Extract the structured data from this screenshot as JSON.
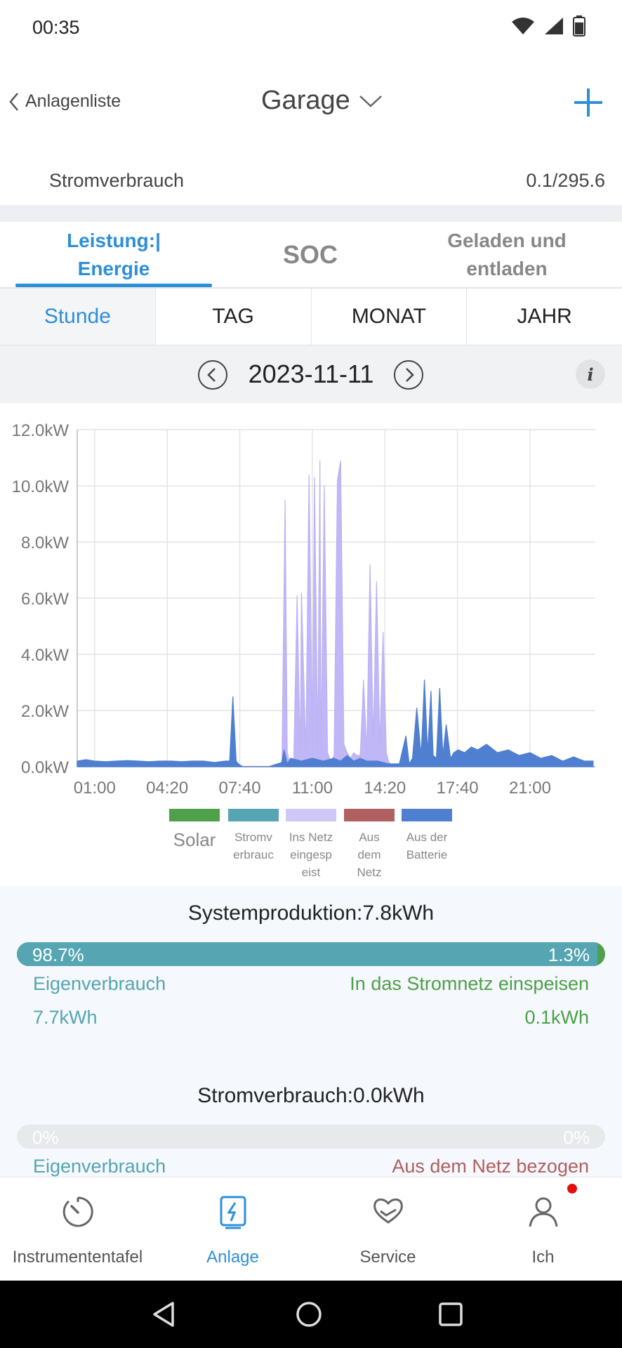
{
  "status": {
    "time": "00:35"
  },
  "header": {
    "back_label": "Anlagenliste",
    "title": "Garage"
  },
  "consumption": {
    "label": "Stromverbrauch",
    "value": "0.1/295.6"
  },
  "tabs": [
    {
      "label": "Leistung:| Energie",
      "line1": "Leistung:|",
      "line2": "Energie"
    },
    {
      "label": "SOC"
    },
    {
      "label": "Geladen und entladen",
      "line1": "Geladen und",
      "line2": "entladen"
    }
  ],
  "periods": [
    "Stunde",
    "TAG",
    "MONAT",
    "JAHR"
  ],
  "date": "2023-11-11",
  "chart_data": {
    "type": "area",
    "y_ticks": [
      "0.0kW",
      "2.0kW",
      "4.0kW",
      "6.0kW",
      "8.0kW",
      "10.0kW",
      "12.0kW"
    ],
    "x_ticks": [
      "01:00",
      "04:20",
      "07:40",
      "11:00",
      "14:20",
      "17:40",
      "21:00"
    ],
    "ylim": [
      0,
      12
    ],
    "legend": [
      {
        "name": "Solar",
        "color": "#4ea04a"
      },
      {
        "name": "Stromv erbrauc",
        "l1": "Stromv",
        "l2": "erbrauc",
        "color": "#55a5b2"
      },
      {
        "name": "Ins Netz eingesp eist",
        "l1": "Ins Netz",
        "l2": "eingesp",
        "l3": "eist",
        "color": "#cfc8f6"
      },
      {
        "name": "Aus dem Netz",
        "l1": "Aus",
        "l2": "dem",
        "l3": "Netz",
        "color": "#b06060"
      },
      {
        "name": "Aus der Batterie",
        "l1": "Aus der",
        "l2": "Batterie",
        "color": "#4f7fd0"
      }
    ],
    "series": [
      {
        "name": "Ins Netz eingesp eist",
        "color": "#bdb3f5",
        "x_hours": [
          9.6,
          9.75,
          9.85,
          10.0,
          10.15,
          10.3,
          10.45,
          10.5,
          10.7,
          10.85,
          11.0,
          11.1,
          11.25,
          11.35,
          11.4,
          11.55,
          11.7,
          11.85,
          12.0,
          12.15,
          12.3,
          12.45,
          12.6,
          12.75,
          12.9,
          13.05,
          13.2,
          13.35,
          13.5,
          13.65,
          13.8,
          13.95,
          14.1,
          14.25,
          14.4,
          14.5,
          14.7
        ],
        "values": [
          0,
          9.5,
          0.5,
          0,
          0.3,
          6.1,
          0.4,
          6.2,
          0.5,
          10.4,
          1.0,
          10.3,
          0.6,
          10.9,
          0.4,
          10.0,
          0.5,
          0.2,
          0.4,
          10.2,
          10.9,
          0.8,
          0.5,
          0.3,
          0.5,
          0.4,
          0.4,
          3.1,
          0.5,
          7.2,
          0.9,
          6.6,
          0.8,
          4.8,
          0.5,
          0.2,
          0
        ]
      },
      {
        "name": "Aus der Batterie",
        "color": "#4f7fd0",
        "x_hours": [
          0.2,
          0.6,
          1.0,
          1.5,
          2.0,
          2.5,
          3.0,
          3.5,
          4.0,
          4.5,
          5.0,
          5.5,
          6.0,
          6.5,
          7.0,
          7.2,
          7.35,
          7.5,
          7.6,
          7.8,
          8.0,
          9.0,
          9.6,
          9.7,
          9.85,
          10.0,
          10.5,
          11.0,
          11.5,
          12.0,
          12.3,
          12.6,
          12.9,
          13.2,
          13.5,
          14.0,
          14.5,
          15.0,
          15.3,
          15.45,
          15.6,
          15.8,
          16.0,
          16.15,
          16.3,
          16.45,
          16.55,
          16.7,
          16.85,
          17.0,
          17.15,
          17.35,
          17.5,
          17.7,
          18.0,
          18.3,
          18.6,
          19.0,
          19.5,
          20.0,
          20.5,
          21.0,
          21.5,
          22.0,
          22.5,
          23.0,
          23.5,
          23.9
        ],
        "values": [
          0.2,
          0.25,
          0.2,
          0.18,
          0.2,
          0.22,
          0.2,
          0.18,
          0.2,
          0.2,
          0.18,
          0.2,
          0.2,
          0.15,
          0.2,
          0.2,
          2.5,
          0.2,
          0.1,
          0,
          0,
          0,
          0.15,
          0.6,
          0.1,
          0.3,
          0.2,
          0.3,
          0.2,
          0.3,
          0.2,
          0.4,
          0.2,
          0.3,
          0.2,
          0.2,
          0.1,
          0.1,
          1.1,
          0.1,
          0.3,
          2.1,
          0.4,
          3.1,
          0.5,
          2.7,
          0.4,
          0.3,
          2.8,
          0.4,
          1.5,
          0.3,
          0.5,
          0.6,
          0.5,
          0.7,
          0.6,
          0.8,
          0.5,
          0.6,
          0.4,
          0.5,
          0.3,
          0.4,
          0.2,
          0.35,
          0.2,
          0.2
        ]
      }
    ]
  },
  "system": {
    "title": "Systemproduktion:7.8kWh",
    "pct_left": "98.7%",
    "pct_right": "1.3%",
    "left_fraction": 0.987,
    "left_label": "Eigenverbrauch",
    "right_label": "In das Stromnetz einspeisen",
    "left_value": "7.7kWh",
    "right_value": "0.1kWh"
  },
  "consumption_stats": {
    "title": "Stromverbrauch:0.0kWh",
    "pct_left": "0%",
    "pct_right": "0%",
    "left_label": "Eigenverbrauch",
    "right_label": "Aus dem Netz bezogen"
  },
  "nav": [
    {
      "label": "Instrumententafel",
      "icon": "gauge-icon"
    },
    {
      "label": "Anlage",
      "icon": "plant-icon"
    },
    {
      "label": "Service",
      "icon": "heart-hand-icon"
    },
    {
      "label": "Ich",
      "icon": "person-icon"
    }
  ],
  "colors": {
    "accent": "#2d8fd8",
    "teal": "#55a5b2",
    "green": "#4ea04a",
    "red": "#b06060"
  }
}
